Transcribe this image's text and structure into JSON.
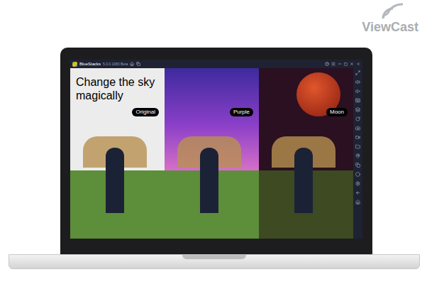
{
  "logo": {
    "text": "ViewCast"
  },
  "window": {
    "title": "BlueStacks",
    "version": "5.0.0.1083 Beta"
  },
  "promo": {
    "title_lines": [
      "Change the sky",
      "magically"
    ]
  },
  "panels": [
    {
      "label": "Original",
      "color": "#ececec"
    },
    {
      "label": "Purple",
      "color": "#8a3fc8"
    },
    {
      "label": "Moon",
      "color": "#2a1020"
    }
  ]
}
